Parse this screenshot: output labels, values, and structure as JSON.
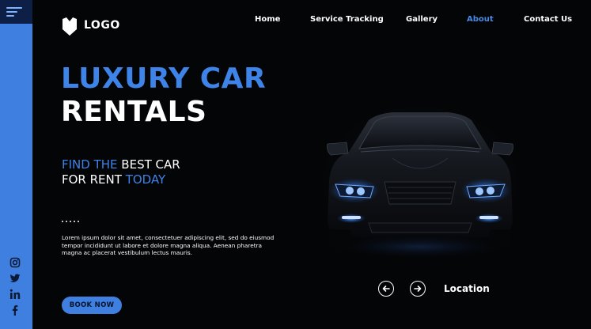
{
  "brand": {
    "logo_text": "LOGO",
    "icon": "shield-logo-icon",
    "accent_color": "#3d83e8"
  },
  "nav": {
    "items": [
      {
        "label": "Home",
        "active": false
      },
      {
        "label": "Service Tracking",
        "active": false
      },
      {
        "label": "Gallery",
        "active": false
      },
      {
        "label": "About",
        "active": true
      },
      {
        "label": "Contact Us",
        "active": false
      }
    ]
  },
  "sidebar": {
    "menu_icon": "hamburger-menu-icon",
    "social": [
      "instagram-icon",
      "twitter-icon",
      "linkedin-icon",
      "facebook-icon"
    ]
  },
  "hero": {
    "title_line1": "LUXURY CAR",
    "title_line2": "RENTALS",
    "tagline": {
      "line1_part1": "FIND THE",
      "line1_part2": "BEST CAR",
      "line2_part1": "FOR RENT",
      "line2_part2": "TODAY"
    },
    "body": "Lorem ipsum dolor sit amet, consectetuer adipiscing elit, sed do eiusmod tempor incididunt ut labore et dolore magna aliqua. Aenean pharetra magna ac placerat vestibulum lectus mauris.",
    "cta": "BOOK NOW"
  },
  "carousel": {
    "prev_icon": "arrow-left-icon",
    "next_icon": "arrow-right-icon",
    "location_label": "Location"
  }
}
